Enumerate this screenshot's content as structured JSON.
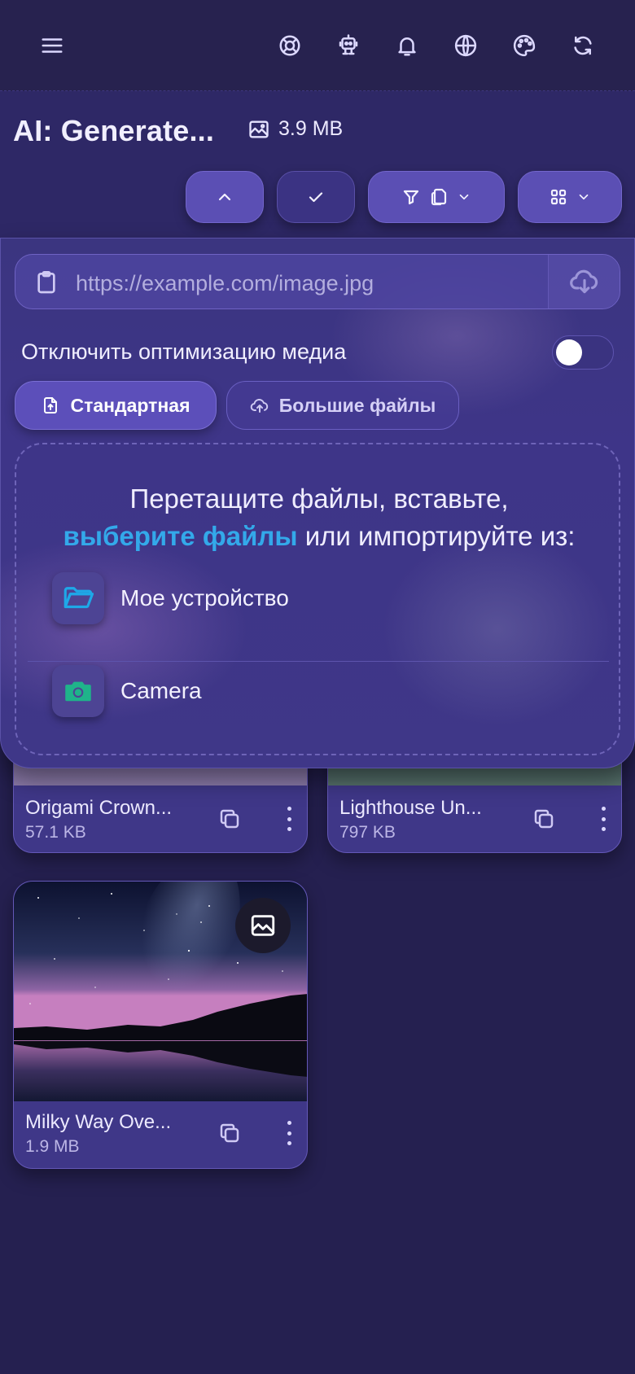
{
  "topbar": {
    "icons": [
      "menu-icon",
      "lifebuoy-icon",
      "robot-icon",
      "bell-icon",
      "globe-icon",
      "palette-icon",
      "refresh-icon"
    ]
  },
  "header": {
    "title": "AI: Generate...",
    "total_size": "3.9 MB",
    "buttons": [
      "chevron-up-icon",
      "check-icon",
      "filter-copy-dropdown",
      "grid-view-dropdown"
    ]
  },
  "upload": {
    "url_placeholder": "https://example.com/image.jpg",
    "optimize_label": "Отключить оптимизацию медиа",
    "optimize_off": false,
    "mode_standard": "Стандартная",
    "mode_large": "Большие файлы",
    "drop_line1": "Перетащите файлы, вставьте,",
    "drop_link": "выберите файлы",
    "drop_line2_rest": " или импортируйте из:",
    "sources": [
      {
        "label": "Мое устройство",
        "icon": "folder-icon"
      },
      {
        "label": "Camera",
        "icon": "camera-icon"
      }
    ]
  },
  "files": [
    {
      "name": "Origami Crown...",
      "size": "57.1 KB"
    },
    {
      "name": "Lighthouse Un...",
      "size": "797 KB"
    },
    {
      "name": "Milky Way Ove...",
      "size": "1.9 MB"
    }
  ],
  "colors": {
    "background": "#252050",
    "accent": "#5b4fb4",
    "link": "#33a9ea",
    "folder": "#1ea8e8",
    "camera": "#1fb38a"
  }
}
